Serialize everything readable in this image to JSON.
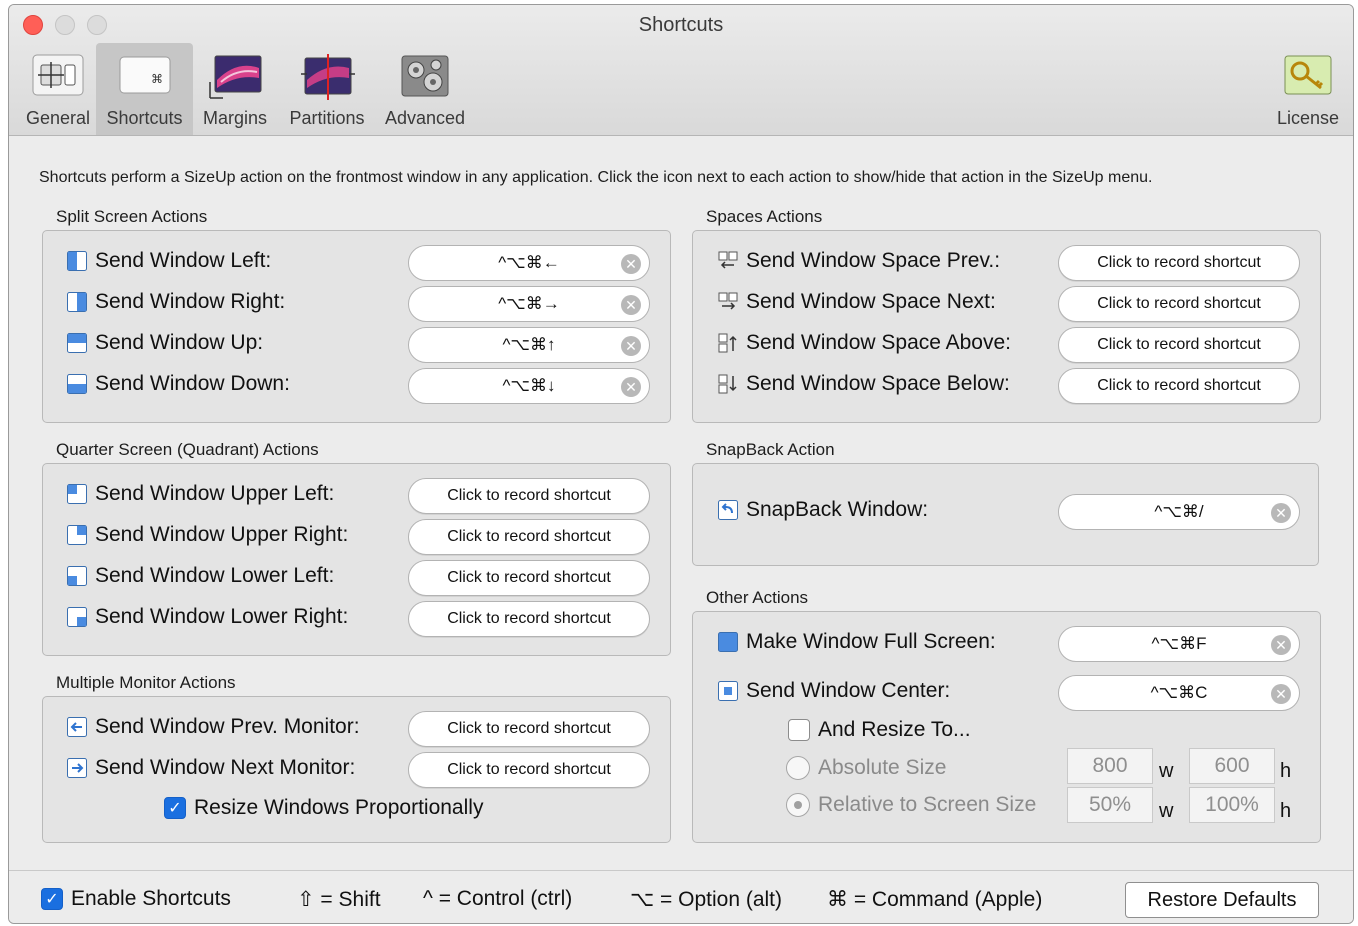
{
  "window": {
    "title": "Shortcuts"
  },
  "toolbar": {
    "items": [
      {
        "label": "General",
        "icon": "general-icon"
      },
      {
        "label": "Shortcuts",
        "icon": "shortcuts-icon",
        "selected": true
      },
      {
        "label": "Margins",
        "icon": "margins-icon"
      },
      {
        "label": "Partitions",
        "icon": "partitions-icon"
      },
      {
        "label": "Advanced",
        "icon": "advanced-icon"
      }
    ],
    "license_label": "License"
  },
  "intro": "Shortcuts perform a SizeUp action on the frontmost window in any application. Click the icon next to each action to show/hide that action in the SizeUp menu.",
  "split": {
    "title": "Split Screen Actions",
    "rows": [
      {
        "label": "Send Window Left:",
        "shortcut": "^⌥⌘←"
      },
      {
        "label": "Send Window Right:",
        "shortcut": "^⌥⌘→"
      },
      {
        "label": "Send Window Up:",
        "shortcut": "^⌥⌘↑"
      },
      {
        "label": "Send Window Down:",
        "shortcut": "^⌥⌘↓"
      }
    ]
  },
  "quarter": {
    "title": "Quarter Screen (Quadrant) Actions",
    "rows": [
      {
        "label": "Send Window Upper Left:",
        "shortcut": "Click to record shortcut"
      },
      {
        "label": "Send Window Upper Right:",
        "shortcut": "Click to record shortcut"
      },
      {
        "label": "Send Window Lower Left:",
        "shortcut": "Click to record shortcut"
      },
      {
        "label": "Send Window Lower Right:",
        "shortcut": "Click to record shortcut"
      }
    ]
  },
  "monitor": {
    "title": "Multiple Monitor Actions",
    "rows": [
      {
        "label": "Send Window Prev. Monitor:",
        "shortcut": "Click to record shortcut"
      },
      {
        "label": "Send Window Next Monitor:",
        "shortcut": "Click to record shortcut"
      }
    ],
    "resize_label": "Resize Windows Proportionally",
    "resize_checked": true
  },
  "spaces": {
    "title": "Spaces Actions",
    "rows": [
      {
        "label": "Send Window Space Prev.:",
        "shortcut": "Click to record shortcut"
      },
      {
        "label": "Send Window Space Next:",
        "shortcut": "Click to record shortcut"
      },
      {
        "label": "Send Window Space Above:",
        "shortcut": "Click to record shortcut"
      },
      {
        "label": "Send Window Space Below:",
        "shortcut": "Click to record shortcut"
      }
    ]
  },
  "snapback": {
    "title": "SnapBack Action",
    "label": "SnapBack Window:",
    "shortcut": "^⌥⌘/"
  },
  "other": {
    "title": "Other Actions",
    "full_label": "Make Window Full Screen:",
    "full_shortcut": "^⌥⌘F",
    "center_label": "Send Window Center:",
    "center_shortcut": "^⌥⌘C",
    "resize_label": "And Resize To...",
    "resize_checked": false,
    "absolute_label": "Absolute Size",
    "relative_label": "Relative to Screen Size",
    "abs_w": "800",
    "abs_h": "600",
    "rel_w": "50%",
    "rel_h": "100%",
    "w_unit": "w",
    "h_unit": "h"
  },
  "footer": {
    "enable_label": "Enable Shortcuts",
    "enable_checked": true,
    "legend_shift": "⇧ = Shift",
    "legend_control": "^ = Control (ctrl)",
    "legend_option": "⌥ = Option (alt)",
    "legend_command": "⌘ = Command (Apple)",
    "restore_label": "Restore Defaults"
  },
  "colors": {
    "accent": "#1a6fe0",
    "close_button": "#ff5f57",
    "panel": "#ececec",
    "group_box": "#e4e4e4"
  }
}
